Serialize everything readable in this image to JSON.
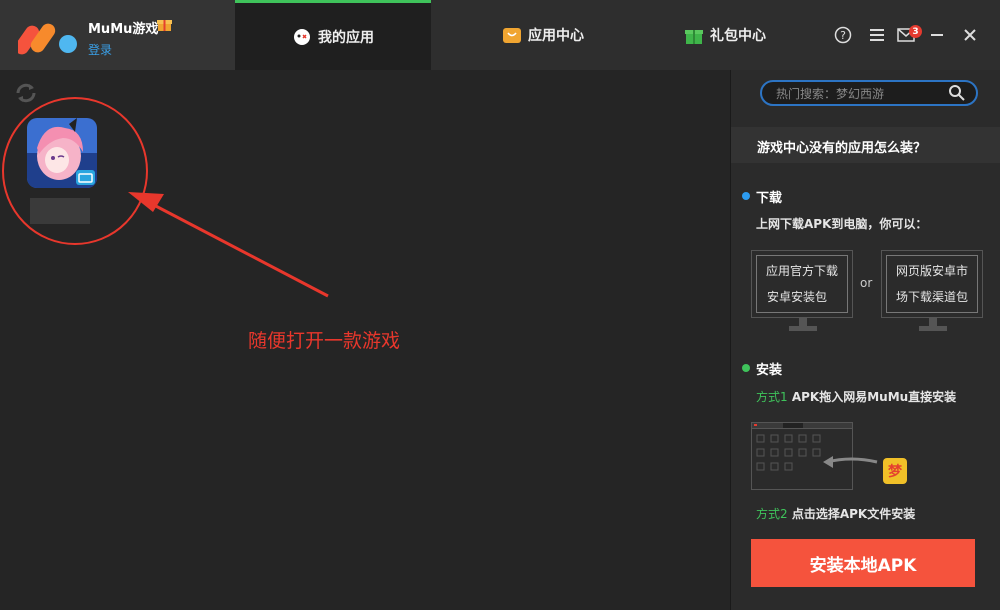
{
  "app": {
    "name": "MuMu游戏",
    "login_label": "登录"
  },
  "tabs": [
    {
      "label": "我的应用",
      "icon": "my-apps-icon",
      "active": true
    },
    {
      "label": "应用中心",
      "icon": "app-store-icon",
      "active": false
    },
    {
      "label": "礼包中心",
      "icon": "gift-icon",
      "active": false
    }
  ],
  "window_controls": {
    "notification_count": "3"
  },
  "my_apps": [
    {
      "name": ""
    }
  ],
  "annotation": {
    "text": "随便打开一款游戏"
  },
  "sidebar": {
    "search_placeholder": "热门搜索：梦幻西游",
    "faq_title": "游戏中心没有的应用怎么装？",
    "download": {
      "title": "下载",
      "desc": "上网下载APK到电脑，你可以：",
      "option1_line1": "应用官方下载",
      "option1_line2": "安卓安装包",
      "or": "or",
      "option2_line1": "网页版安卓市",
      "option2_line2": "场下载渠道包"
    },
    "install": {
      "title": "安装",
      "method1_label": "方式1",
      "method1_text": "APK拖入网易MuMu直接安装",
      "method2_label": "方式2",
      "method2_text": "点击选择APK文件安装"
    },
    "install_button": "安装本地APK"
  },
  "colors": {
    "accent_green": "#3fc35b",
    "accent_red": "#f5533d",
    "link_blue": "#3aa0e8",
    "annotation_red": "#e8372c"
  }
}
